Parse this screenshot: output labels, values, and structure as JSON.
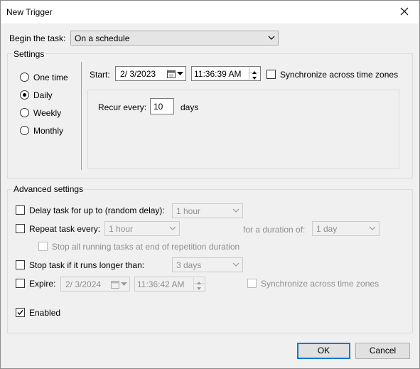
{
  "window": {
    "title": "New Trigger"
  },
  "begin": {
    "label": "Begin the task:",
    "value": "On a schedule"
  },
  "settings": {
    "title": "Settings",
    "options": [
      "One time",
      "Daily",
      "Weekly",
      "Monthly"
    ],
    "selected": "Daily",
    "start_label": "Start:",
    "start_date": "2/  3/2023",
    "start_time": "11:36:39 AM",
    "sync_label": "Synchronize across time zones",
    "recur_label": "Recur every:",
    "recur_value": "10",
    "recur_unit": "days"
  },
  "advanced": {
    "title": "Advanced settings",
    "delay_label": "Delay task for up to (random delay):",
    "delay_value": "1 hour",
    "repeat_label": "Repeat task every:",
    "repeat_value": "1 hour",
    "duration_label": "for a duration of:",
    "duration_value": "1 day",
    "stop_running_label": "Stop all running tasks at end of repetition duration",
    "stop_longer_label": "Stop task if it runs longer than:",
    "stop_longer_value": "3 days",
    "expire_label": "Expire:",
    "expire_date": "2/  3/2024",
    "expire_time": "11:36:42 AM",
    "expire_sync_label": "Synchronize across time zones",
    "enabled_label": "Enabled"
  },
  "buttons": {
    "ok": "OK",
    "cancel": "Cancel"
  }
}
